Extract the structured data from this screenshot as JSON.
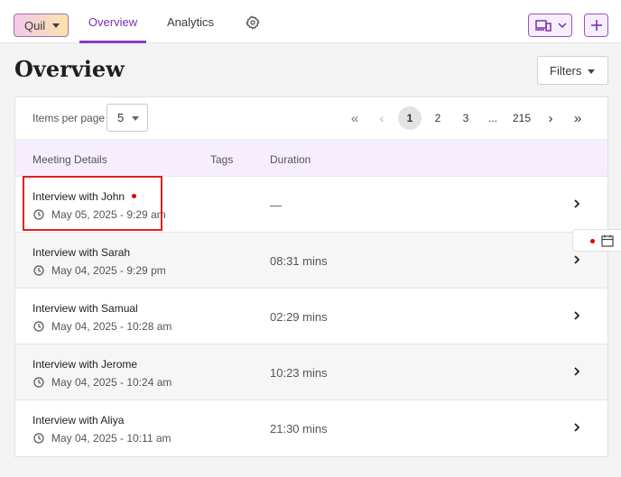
{
  "topbar": {
    "brand_label": "Quil",
    "tabs": [
      {
        "label": "Overview",
        "active": true
      },
      {
        "label": "Analytics",
        "active": false
      }
    ]
  },
  "page": {
    "title": "Overview",
    "filters_label": "Filters"
  },
  "pagination": {
    "items_per_page_label": "Items per page",
    "items_per_page_value": "5",
    "pages": [
      "1",
      "2",
      "3"
    ],
    "ellipsis": "...",
    "last_page": "215",
    "current_page": "1"
  },
  "table": {
    "columns": [
      "Meeting Details",
      "Tags",
      "Duration"
    ],
    "rows": [
      {
        "title": "Interview with John",
        "date": "May 05, 2025 - 9:29 am",
        "duration": "—",
        "new": true
      },
      {
        "title": "Interview with Sarah",
        "date": "May 04, 2025 - 9:29 pm",
        "duration": "08:31 mins",
        "new": false
      },
      {
        "title": "Interview with Samual",
        "date": "May 04, 2025 - 10:28 am",
        "duration": "02:29 mins",
        "new": false
      },
      {
        "title": "Interview with Jerome",
        "date": "May 04, 2025 - 10:24 am",
        "duration": "10:23 mins",
        "new": false
      },
      {
        "title": "Interview with Aliya",
        "date": "May 04, 2025 - 10:11 am",
        "duration": "21:30 mins",
        "new": false
      }
    ]
  },
  "colors": {
    "accent": "#8a3ac4",
    "header_bg": "#f6eefc",
    "alert": "#e00000"
  }
}
